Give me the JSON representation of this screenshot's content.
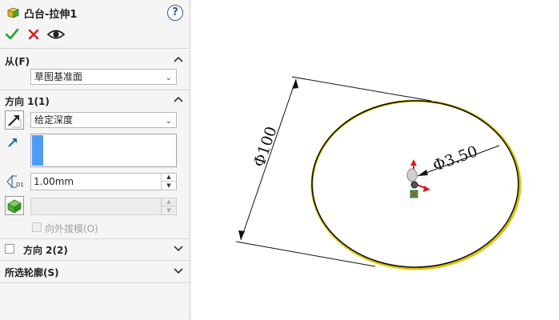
{
  "panel": {
    "title": "凸台-拉伸1",
    "help_label": "?",
    "from_group": {
      "title": "从(F)",
      "start_condition": "草图基准面"
    },
    "direction1": {
      "title": "方向 1(1)",
      "end_condition": "给定深度",
      "depth_value": "1.00mm",
      "depth_icon_label": "D1",
      "draft_outward_label": "向外拔模(O)"
    },
    "direction2": {
      "title": "方向 2(2)"
    },
    "selected_contours": {
      "title": "所选轮廓(S)"
    }
  },
  "graphics": {
    "diameter_large": "Φ100",
    "diameter_small": "Φ3.50"
  },
  "colors": {
    "ok_green": "#2e9c2e",
    "cancel_red": "#d42020",
    "selection_blue": "#4e9cf5",
    "circle_highlight": "#d8c400"
  }
}
